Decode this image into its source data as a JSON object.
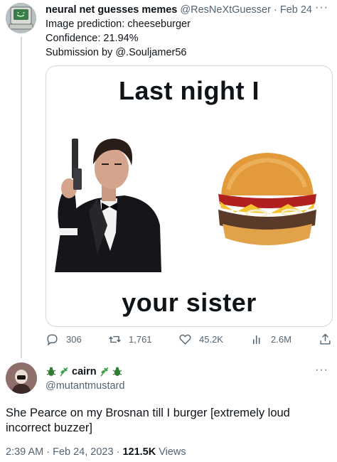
{
  "tweet": {
    "display_name": "neural net guesses memes",
    "handle": "@ResNeXtGuesser",
    "date": "· Feb 24",
    "more": "···",
    "lines": [
      "Image prediction: cheeseburger",
      "Confidence: 21.94%",
      "Submission by @.Souljamer56"
    ],
    "meme": {
      "top_text": "Last night I",
      "bottom_text": "your sister"
    },
    "actions": {
      "replies": "306",
      "retweets": "1,761",
      "likes": "45.2K",
      "views": "2.6M"
    }
  },
  "reply": {
    "display_name": "cairn",
    "handle": "@mutantmustard",
    "more": "···",
    "text": "She Pearce on my Brosnan till I burger [extremely loud incorrect buzzer]",
    "time": "2:39 AM · Feb 24, 2023 · ",
    "views_count": "121.5K",
    "views_label": " Views"
  },
  "colors": {
    "text": "#0f1419",
    "muted": "#536471",
    "border": "#cfd9de",
    "bug_green": "#2e7d32",
    "herb_green": "#43a047"
  },
  "icons": [
    "computer-avatar-icon",
    "reply-icon",
    "retweet-icon",
    "like-icon",
    "views-icon",
    "share-icon",
    "bug-icon",
    "herb-icon"
  ]
}
